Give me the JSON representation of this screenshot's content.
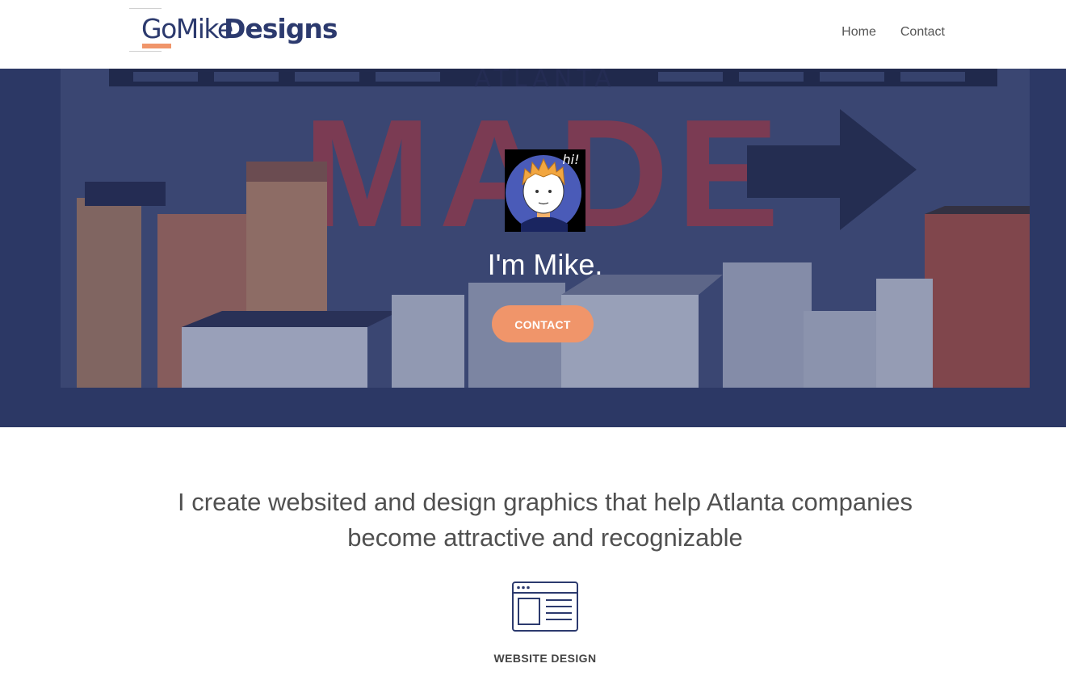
{
  "header": {
    "logo": {
      "part1": "GoMike",
      "part2": "Designs"
    },
    "nav": [
      {
        "label": "Home"
      },
      {
        "label": "Contact"
      }
    ]
  },
  "hero": {
    "photo_sign_text": "ATLANTA",
    "photo_sign_big": "MADE",
    "avatar_caption": "hi!",
    "title": "I'm Mike.",
    "button_label": "CONTACT"
  },
  "intro": {
    "line1": "I create websited and design graphics that help Atlanta companies",
    "line2": "become attractive and recognizable"
  },
  "services": [
    {
      "label": "WEBSITE DESIGN",
      "icon": "browser-window-icon"
    }
  ],
  "colors": {
    "accent": "#f0956a",
    "brand_navy": "#2c3a6e",
    "hero_bg": "#2e3b66",
    "text": "#505050"
  }
}
